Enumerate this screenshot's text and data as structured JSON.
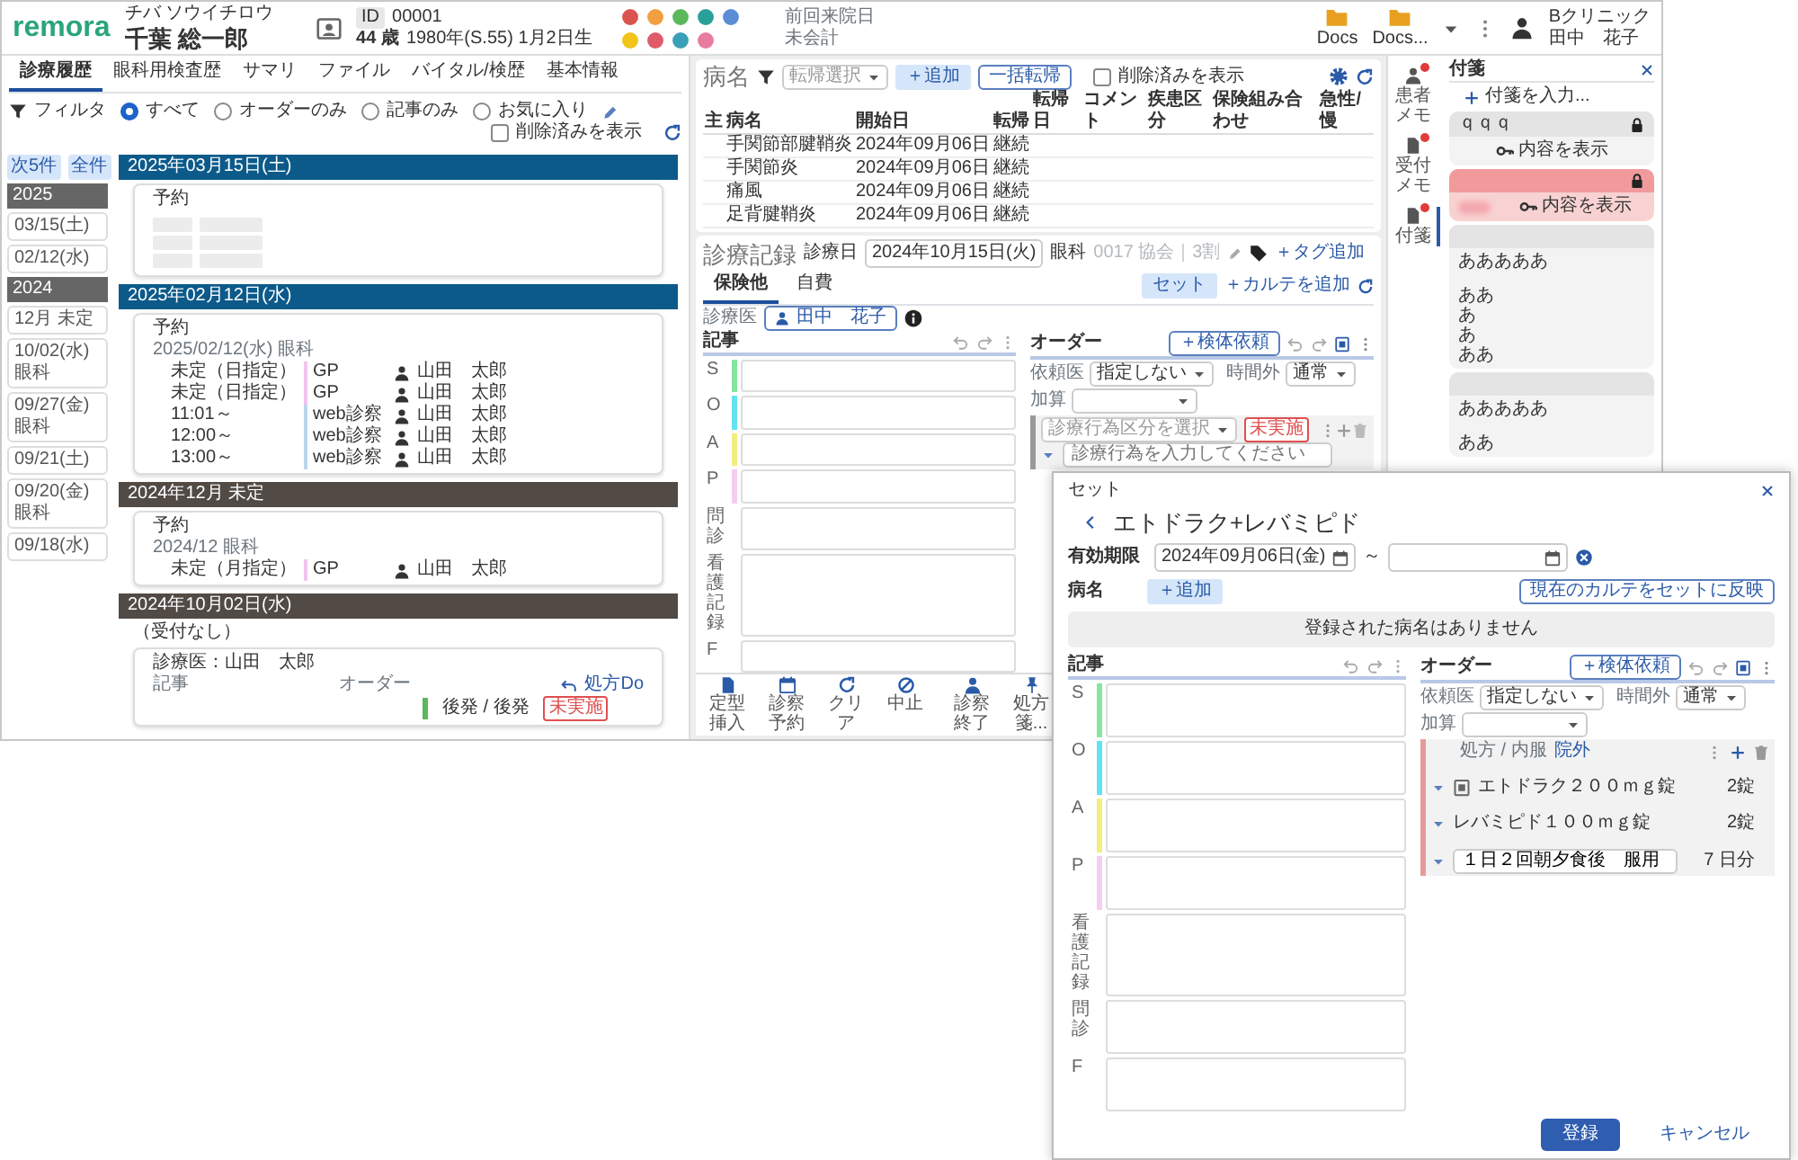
{
  "header": {
    "logo": "remora",
    "patient_kana": "チバ ソウイチロウ",
    "patient_name": "千葉 総一郎",
    "id_label": "ID",
    "patient_id": "00001",
    "age": "44 歳",
    "birth": "1980年(S.55) 1月2日生",
    "status_icons": [
      {
        "color": "#d9534f"
      },
      {
        "color": "#f0a040"
      },
      {
        "color": "#5cb85c"
      },
      {
        "color": "#2aa198"
      },
      {
        "color": "#5b8dd6"
      },
      {
        "color": "#f0c419"
      },
      {
        "color": "#e05a6a"
      },
      {
        "color": "#3aa0b8"
      },
      {
        "color": "#e87ba0"
      }
    ],
    "last_visit_label": "前回来院日",
    "account_label": "未会計",
    "docs": [
      "Docs",
      "Docs..."
    ],
    "clinic": "Bクリニック",
    "user": "田中　花子"
  },
  "history": {
    "tabs": [
      {
        "label": "診療履歴",
        "selected": true
      },
      {
        "label": "眼科用検査歴",
        "selected": false
      },
      {
        "label": "サマリ",
        "selected": false
      },
      {
        "label": "ファイル",
        "selected": false
      },
      {
        "label": "バイタル/検歴",
        "selected": false
      },
      {
        "label": "基本情報",
        "selected": false
      }
    ],
    "filter_label": "フィルタ",
    "filters": [
      {
        "label": "すべて",
        "selected": true
      },
      {
        "label": "オーダーのみ",
        "selected": false
      },
      {
        "label": "記事のみ",
        "selected": false
      },
      {
        "label": "お気に入り",
        "selected": false
      }
    ],
    "show_deleted": {
      "label": "削除済みを表示",
      "checked": false
    },
    "nav_buttons": [
      "次5件",
      "全件"
    ],
    "dates": [
      {
        "kind": "year",
        "label": "2025"
      },
      {
        "kind": "date",
        "label": "03/15(土)"
      },
      {
        "kind": "date",
        "label": "02/12(水)"
      },
      {
        "kind": "year",
        "label": "2024"
      },
      {
        "kind": "date",
        "label": "12月 未定"
      },
      {
        "kind": "date",
        "label": "10/02(水)",
        "dept": "眼科"
      },
      {
        "kind": "date",
        "label": "09/27(金)",
        "dept": "眼科"
      },
      {
        "kind": "date",
        "label": "09/21(土)"
      },
      {
        "kind": "date",
        "label": "09/20(金)",
        "dept": "眼科"
      },
      {
        "kind": "date",
        "label": "09/18(水)"
      }
    ],
    "entries": [
      {
        "title": "2025年03月15日(土)",
        "color": "#0c5a8a",
        "card": {
          "kind": "loading",
          "heading": "予約"
        }
      },
      {
        "title": "2025年02月12日(水)",
        "color": "#0c5a8a",
        "card": {
          "kind": "reservation",
          "heading": "予約",
          "date_line": "2025/02/12(水) 眼科",
          "rows": [
            {
              "time": "未定（日指定）",
              "type": "GP",
              "color": "#f2c4ef",
              "doctor": "山田　太郎"
            },
            {
              "time": "未定（日指定）",
              "type": "GP",
              "color": "#f2c4ef",
              "doctor": "山田　太郎"
            },
            {
              "time": "11:01～",
              "type": "web診察",
              "color": "#bcd4ee",
              "doctor": "山田　太郎"
            },
            {
              "time": "12:00～",
              "type": "web診察",
              "color": "#bcd4ee",
              "doctor": "山田　太郎"
            },
            {
              "time": "13:00～",
              "type": "web診察",
              "color": "#bcd4ee",
              "doctor": "山田　太郎"
            }
          ]
        }
      },
      {
        "title": "2024年12月 未定",
        "color": "#514a45",
        "card": {
          "kind": "reservation",
          "heading": "予約",
          "date_line": "2024/12 眼科",
          "rows": [
            {
              "time": "未定（月指定）",
              "type": "GP",
              "color": "#f2c4ef",
              "doctor": "山田　太郎"
            }
          ]
        }
      },
      {
        "title": "2024年10月02日(水)",
        "color": "#514a45",
        "note": "（受付なし）",
        "card": {
          "kind": "visit",
          "doctor": "診療医：山田　太郎",
          "record_label": "記事",
          "order_label": "オーダー",
          "do_link": "処方Do",
          "order_item": "後発 / 後発",
          "status": "未実施"
        }
      }
    ]
  },
  "disease": {
    "title": "病名",
    "filter_placeholder": "転帰選択",
    "add": "＋追加",
    "bulk": "一括転帰",
    "show_deleted": {
      "label": "削除済みを表示",
      "checked": false
    },
    "columns": [
      "主",
      "病名",
      "開始日",
      "転帰",
      "転帰日",
      "コメント",
      "疾患区分",
      "保険組み合わせ",
      "急性/慢"
    ],
    "rows": [
      {
        "name": "手関節部腱鞘炎",
        "start": "2024年09月06日",
        "outcome": "継続"
      },
      {
        "name": "手関節炎",
        "start": "2024年09月06日",
        "outcome": "継続"
      },
      {
        "name": "痛風",
        "start": "2024年09月06日",
        "outcome": "継続"
      },
      {
        "name": "足背腱鞘炎",
        "start": "2024年09月06日",
        "outcome": "継続"
      }
    ]
  },
  "record": {
    "title": "診療記録",
    "date_label": "診療日",
    "date": "2024年10月15日(火)",
    "dept": "眼科",
    "insurance": "0017 協会｜3割",
    "tag_add": "＋タグ追加",
    "tabs": [
      {
        "label": "保険他",
        "selected": true
      },
      {
        "label": "自費",
        "selected": false
      }
    ],
    "set_button": "セット",
    "add_karte": "＋カルテを追加",
    "doctor_label": "診療医",
    "doctor": "田中　花子",
    "notes_label": "記事",
    "sections": [
      {
        "label": "S",
        "color": "#86e6a0"
      },
      {
        "label": "O",
        "color": "#62e3f2"
      },
      {
        "label": "A",
        "color": "#f3ee80"
      },
      {
        "label": "P",
        "color": "#f5cdf2"
      },
      {
        "label": "問診"
      },
      {
        "label": "看護記録"
      },
      {
        "label": "F"
      }
    ],
    "order": {
      "label": "オーダー",
      "specimen": "＋検体依頼",
      "doctor_label": "依頼医",
      "doctor_value": "指定しない",
      "time_label": "時間外",
      "time_value": "通常",
      "addon_label": "加算",
      "blocks": [
        {
          "kind": "procedure",
          "category_placeholder": "診療行為区分を選択",
          "status": "未実施",
          "input_placeholder": "診療行為を入力してください"
        }
      ]
    },
    "toolbar": [
      "定型挿入",
      "診察予約",
      "クリア",
      "中止",
      "診察終了",
      "処方箋..."
    ]
  },
  "notes": {
    "rail": [
      {
        "label": "患者メモ",
        "selected": false,
        "alert": true
      },
      {
        "label": "受付メモ",
        "selected": false,
        "alert": true
      },
      {
        "label": "付箋",
        "selected": true,
        "alert": true
      }
    ],
    "title": "付箋",
    "add": "付箋を入力...",
    "items": [
      {
        "color": "#e4e4e4",
        "locked": true,
        "title": "ｑｑｑ",
        "masked": false,
        "show": "内容を表示"
      },
      {
        "color": "#f09a9c",
        "locked": true,
        "masked": true,
        "show": "内容を表示"
      },
      {
        "color": "#e4e4e4",
        "locked": false,
        "masked": false,
        "lines": [
          "あああああ",
          "ああ",
          "あ",
          "あ",
          "ああ"
        ]
      },
      {
        "color": "#e4e4e4",
        "locked": false,
        "masked": false,
        "lines": [
          "あああああ",
          "ああ"
        ]
      }
    ]
  },
  "dialog": {
    "title": "セット",
    "set_name": "エトドラク+レバミピド",
    "validity_label": "有効期限",
    "from": "2024年09月06日(金)",
    "tilde": "～",
    "apply": "現在のカルテをセットに反映",
    "disease_label": "病名",
    "add": "＋追加",
    "empty": "登録された病名はありません",
    "notes_label": "記事",
    "sections": [
      {
        "label": "S",
        "color": "#86e6a0"
      },
      {
        "label": "O",
        "color": "#62e3f2"
      },
      {
        "label": "A",
        "color": "#f3ee80"
      },
      {
        "label": "P",
        "color": "#f5cdf2"
      },
      {
        "label": "看護記録"
      },
      {
        "label": "問診"
      },
      {
        "label": "F"
      }
    ],
    "order": {
      "label": "オーダー",
      "specimen": "＋検体依頼",
      "doctor_label": "依頼医",
      "doctor_value": "指定しない",
      "time_label": "時間外",
      "time_value": "通常",
      "addon_label": "加算",
      "blocks": [
        {
          "kind": "prescription",
          "type": "処方 / 内服",
          "place": "院外",
          "drugs": [
            {
              "name": "エトドラク２００ｍｇ錠",
              "qty": "2錠",
              "marked": true
            },
            {
              "name": "レバミピド１００ｍｇ錠",
              "qty": "2錠",
              "marked": false
            }
          ],
          "usage": "１日２回朝夕食後　服用",
          "days": "7 日分"
        }
      ]
    },
    "submit": "登録",
    "cancel": "キャンセル"
  }
}
